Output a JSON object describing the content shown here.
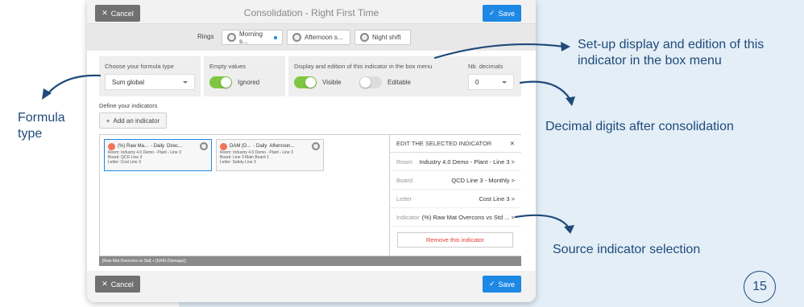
{
  "header": {
    "cancel_label": "Cancel",
    "title": "Consolidation - Right First Time",
    "save_label": "Save"
  },
  "rings": {
    "label": "Rings",
    "items": [
      {
        "label": "Morning s..."
      },
      {
        "label": "Afternoon s..."
      },
      {
        "label": "Night shift"
      }
    ]
  },
  "formula_type": {
    "label": "Choose your formula type",
    "value": "Sum global"
  },
  "empty_values": {
    "label": "Empty values",
    "toggle_label": "Ignored"
  },
  "display": {
    "label": "Display and edition of this indicator in the box menu",
    "visible_label": "Visible",
    "editable_label": "Editable"
  },
  "decimals": {
    "label": "Nb. decimals",
    "value": "0"
  },
  "define": {
    "label": "Define your indicators",
    "add_label": "Add an indicator"
  },
  "cards": [
    {
      "title": "(%) Raw Ma...",
      "freq": "- Daily",
      "ring": "Direc...",
      "room": "Room: Industry 4.0 Demo - Plant - Line 3",
      "board": "Board: QCD Line 3",
      "letter": "Letter: Cost Line 3"
    },
    {
      "title": "DAM (D...",
      "freq": "- Daily",
      "ring": "Afternoon...",
      "room": "Room: Industry 4.0 Demo - Plant - Line 3",
      "board": "Board: Line 3 Main Board 1",
      "letter": "Letter: Safety Line 3"
    }
  ],
  "edit_panel": {
    "title": "EDIT THE SELECTED INDICATOR",
    "rows": [
      {
        "key": "Room",
        "value": "Industry 4.0 Demo - Plant - Line 3 >"
      },
      {
        "key": "Board",
        "value": "QCD Line 3 - Monthly >"
      },
      {
        "key": "Letter",
        "value": "Cost Line 3 >"
      },
      {
        "key": "Indicator",
        "value": "(%) Raw Mat Overcons vs Std ... >"
      }
    ],
    "remove_label": "Remove this indicator"
  },
  "formula_bar": "[Raw Mat Overcons vs Std] + [DAM (Damage)]",
  "footer": {
    "cancel_label": "Cancel",
    "save_label": "Save"
  },
  "annotations": {
    "formula_line1": "Formula",
    "formula_line2": "type",
    "display_line1": "Set-up display and edition of this",
    "display_line2": "indicator in the box menu",
    "decimals": "Decimal digits after consolidation",
    "source": "Source indicator selection"
  },
  "page_number": "15",
  "colors": {
    "accent": "#1e88e5",
    "toggle_on": "#7fc742",
    "annotation": "#1f4a7a",
    "background_panel": "#e3eef7"
  }
}
